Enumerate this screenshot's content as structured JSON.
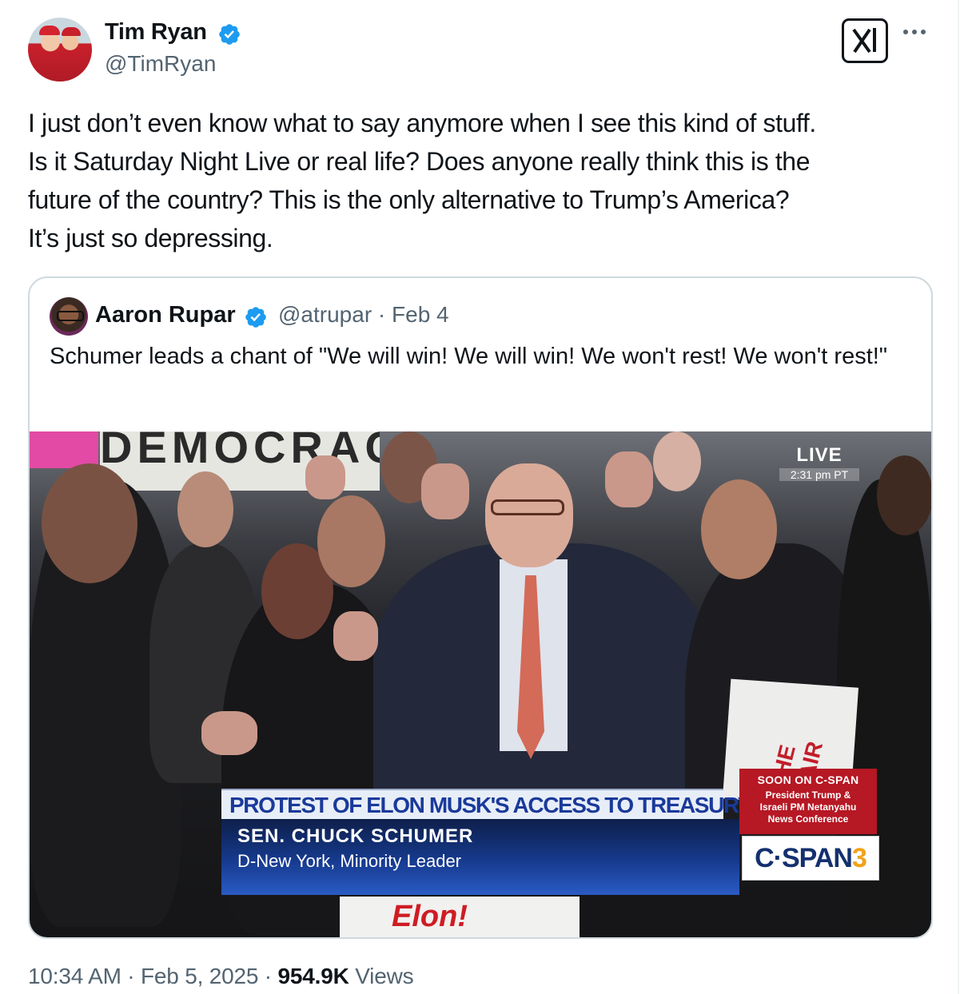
{
  "author": {
    "name": "Tim Ryan",
    "handle": "@TimRyan"
  },
  "tweet": {
    "lines": [
      "I just don’t even know what to say anymore when I see this kind of stuff.",
      "Is it Saturday Night Live or real life?  Does anyone really think this is the",
      "future of the country?  This is the only alternative to Trump’s America?",
      "It’s just so depressing."
    ]
  },
  "quoted": {
    "name": "Aaron Rupar",
    "meta": "@atrupar · Feb 4",
    "text": "Schumer leads a chant of \"We will win! We will win! We won't rest! We won't rest!\"",
    "video": {
      "sign_text": "DEMOCRACY",
      "live_label": "LIVE",
      "live_time": "2:31 pm PT",
      "chyron_headline": "PROTEST OF ELON MUSK'S ACCESS TO TREASURY DEPT.",
      "chyron_name": "SEN. CHUCK SCHUMER",
      "chyron_title": "D-New York, Minority Leader",
      "soon_heading": "SOON ON C-SPAN",
      "soon_body": [
        "President Trump &",
        "Israeli PM Netanyahu",
        "News Conference"
      ],
      "network_prefix": "C·SPAN",
      "network_number": "3",
      "bottom_sign": "Elon!",
      "paper_sign": "THE HAIR"
    }
  },
  "footer": {
    "time": "10:34 AM · Feb 5, 2025 · ",
    "views_count": "954.9K",
    "views_label": " Views"
  },
  "icons": {
    "verified": "verified-badge-icon",
    "grok": "grok-icon",
    "more": "more-icon"
  },
  "colors": {
    "verified_blue": "#1d9bf0",
    "secondary_text": "#536471",
    "border": "#cfd9de"
  }
}
